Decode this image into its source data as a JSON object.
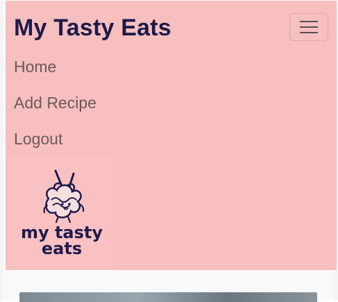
{
  "navbar": {
    "brand": "My Tasty Eats",
    "toggler_icon": "hamburger-menu-icon",
    "links": [
      {
        "label": "Home"
      },
      {
        "label": "Add Recipe"
      },
      {
        "label": "Logout"
      }
    ],
    "logo": {
      "line1": "my tasty",
      "line2": "eats",
      "icon": "noodle-bowl-mascot-icon"
    }
  },
  "colors": {
    "navbar_bg": "#f8bfbf",
    "brand_text": "#1c1a4a",
    "nav_text": "#6a5a5a",
    "logo_text": "#1e1b4d",
    "page_bg": "#f8f9fa"
  }
}
